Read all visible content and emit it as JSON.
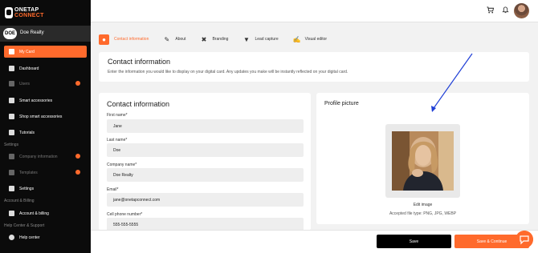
{
  "brand": {
    "line1": "ONETAP",
    "line2": "CONNECT"
  },
  "account": {
    "avatar_text": "DOE",
    "name": "Doe Realty"
  },
  "sidebar": {
    "items": [
      {
        "label": "My Card",
        "icon": "card-icon"
      },
      {
        "label": "Dashboard",
        "icon": "dashboard-icon"
      },
      {
        "label": "Users",
        "icon": "users-icon"
      },
      {
        "label": "Smart accessories",
        "icon": "accessories-icon"
      },
      {
        "label": "Shop smart accessories",
        "icon": "shop-icon"
      },
      {
        "label": "Tutorials",
        "icon": "tutorials-icon"
      },
      {
        "label": "Company information",
        "icon": "company-icon"
      },
      {
        "label": "Templates",
        "icon": "templates-icon"
      },
      {
        "label": "Settings",
        "icon": "gear-icon"
      },
      {
        "label": "Account & billing",
        "icon": "billing-icon"
      },
      {
        "label": "Help center",
        "icon": "help-icon"
      }
    ],
    "sections": {
      "settings": "Settings",
      "billing": "Account & Billing",
      "help": "Help Center & Support"
    }
  },
  "tabs": [
    {
      "label": "Contact information"
    },
    {
      "label": "About"
    },
    {
      "label": "Branding"
    },
    {
      "label": "Lead capture"
    },
    {
      "label": "Visual editor"
    }
  ],
  "info": {
    "title": "Contact information",
    "description": "Enter the information you would like to display on your digital card. Any updates you make will be instantly reflected on your digital card."
  },
  "form": {
    "title": "Contact information",
    "fields": [
      {
        "label": "First name*",
        "value": "Jane"
      },
      {
        "label": "Last name*",
        "value": "Doe"
      },
      {
        "label": "Company name*",
        "value": "Doe Realty"
      },
      {
        "label": "Email*",
        "value": "jane@onetapconnect.com"
      },
      {
        "label": "Cell phone number*",
        "value": "555-555-5555"
      }
    ]
  },
  "profile": {
    "title": "Profile picture",
    "edit_label": "Edit image",
    "file_types": "Accepted file type: PNG, JPG, WEBP"
  },
  "actions": {
    "save": "Save",
    "save_continue": "Save & Continue"
  },
  "colors": {
    "accent": "#ff6a2c",
    "sidebar_bg": "#0b0b0b",
    "annotation_arrow": "#1f3fd6"
  }
}
